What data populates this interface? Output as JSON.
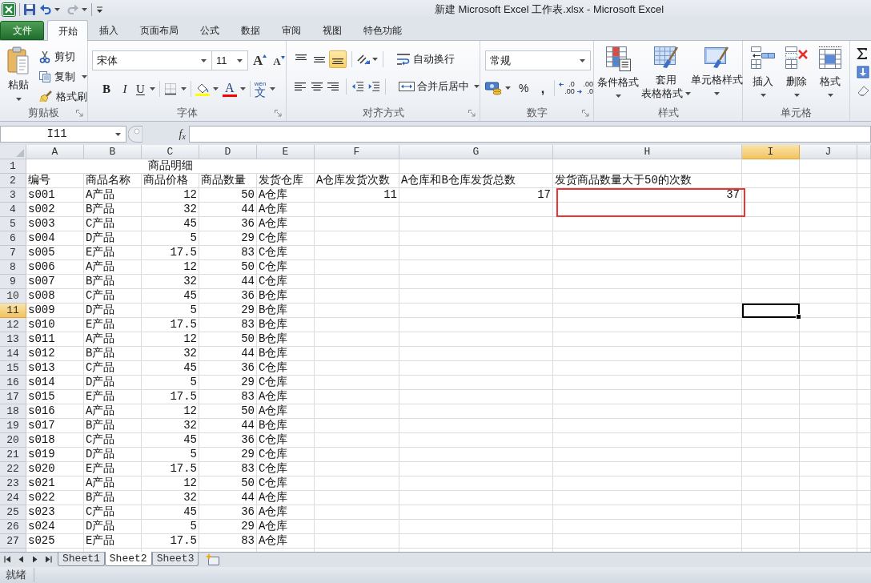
{
  "window": {
    "title": "新建 Microsoft Excel 工作表.xlsx - Microsoft Excel"
  },
  "ribbon_tabs": [
    {
      "label": "文件",
      "kind": "file",
      "selected": false
    },
    {
      "label": "开始",
      "kind": "tab",
      "selected": true
    },
    {
      "label": "插入",
      "kind": "tab",
      "selected": false
    },
    {
      "label": "页面布局",
      "kind": "tab",
      "selected": false
    },
    {
      "label": "公式",
      "kind": "tab",
      "selected": false
    },
    {
      "label": "数据",
      "kind": "tab",
      "selected": false
    },
    {
      "label": "审阅",
      "kind": "tab",
      "selected": false
    },
    {
      "label": "视图",
      "kind": "tab",
      "selected": false
    },
    {
      "label": "特色功能",
      "kind": "tab",
      "selected": false
    }
  ],
  "clipboard": {
    "label": "剪贴板",
    "paste": "粘贴",
    "cut": "剪切",
    "copy": "复制",
    "format_painter": "格式刷"
  },
  "font": {
    "label": "字体",
    "name": "宋体",
    "size": "11",
    "grow": "A",
    "shrink": "A",
    "bold": "B",
    "italic": "I",
    "underline": "U",
    "color_letter": "A",
    "phonetic": "wén",
    "phonetic_char": "文"
  },
  "alignment": {
    "label": "对齐方式",
    "vertical": [
      {
        "kind": "top",
        "selected": false
      },
      {
        "kind": "middle",
        "selected": false
      },
      {
        "kind": "bottom",
        "selected": true
      }
    ],
    "horizontal": [
      {
        "kind": "left",
        "selected": false
      },
      {
        "kind": "center",
        "selected": false
      },
      {
        "kind": "right",
        "selected": false
      }
    ],
    "wrap_text": "自动换行",
    "merge_center": "合并后居中"
  },
  "number": {
    "label": "数字",
    "format": "常规",
    "percent": "%",
    "comma": ",",
    "increase_decimal": [
      ".0",
      ".00"
    ],
    "decrease_decimal": [
      ".00",
      ".0"
    ]
  },
  "styles": {
    "label": "样式",
    "buttons": [
      {
        "kind": "conditional",
        "lines": [
          "条件格式"
        ]
      },
      {
        "kind": "table",
        "lines": [
          "套用",
          "表格格式"
        ]
      },
      {
        "kind": "cell",
        "lines": [
          "单元格样式"
        ]
      }
    ]
  },
  "cells": {
    "label": "单元格",
    "buttons": [
      {
        "kind": "insert",
        "label": "插入"
      },
      {
        "kind": "delete",
        "label": "删除"
      },
      {
        "kind": "format",
        "label": "格式"
      }
    ]
  },
  "formula_bar": {
    "name_box": "I11",
    "fx": "f$_{x}$"
  },
  "sheet": {
    "columns": [
      {
        "label": "A",
        "selected": false
      },
      {
        "label": "B",
        "selected": false
      },
      {
        "label": "C",
        "selected": false
      },
      {
        "label": "D",
        "selected": false
      },
      {
        "label": "E",
        "selected": false
      },
      {
        "label": "F",
        "selected": false
      },
      {
        "label": "G",
        "selected": false
      },
      {
        "label": "H",
        "selected": false
      },
      {
        "label": "I",
        "selected": true
      },
      {
        "label": "J",
        "selected": false
      }
    ],
    "rows": [
      {
        "label": "1",
        "selected": false
      },
      {
        "label": "2",
        "selected": false
      },
      {
        "label": "3",
        "selected": false
      },
      {
        "label": "4",
        "selected": false
      },
      {
        "label": "5",
        "selected": false
      },
      {
        "label": "6",
        "selected": false
      },
      {
        "label": "7",
        "selected": false
      },
      {
        "label": "8",
        "selected": false
      },
      {
        "label": "9",
        "selected": false
      },
      {
        "label": "10",
        "selected": false
      },
      {
        "label": "11",
        "selected": true
      },
      {
        "label": "12",
        "selected": false
      },
      {
        "label": "13",
        "selected": false
      },
      {
        "label": "14",
        "selected": false
      },
      {
        "label": "15",
        "selected": false
      },
      {
        "label": "16",
        "selected": false
      },
      {
        "label": "17",
        "selected": false
      },
      {
        "label": "18",
        "selected": false
      },
      {
        "label": "19",
        "selected": false
      },
      {
        "label": "20",
        "selected": false
      },
      {
        "label": "21",
        "selected": false
      },
      {
        "label": "22",
        "selected": false
      },
      {
        "label": "23",
        "selected": false
      },
      {
        "label": "24",
        "selected": false
      },
      {
        "label": "25",
        "selected": false
      },
      {
        "label": "26",
        "selected": false
      },
      {
        "label": "27",
        "selected": false
      }
    ],
    "title": "商品明细",
    "headers": [
      "编号",
      "商品名称",
      "商品价格",
      "商品数量",
      "发货仓库",
      "A仓库发货次数",
      "A仓库和B仓库发货总数",
      "发货商品数量大于50的次数"
    ],
    "summary": [
      "11",
      "17",
      "37"
    ],
    "records": [
      {
        "id": "s001",
        "name": "A产品",
        "price": "12",
        "quantity": "50",
        "warehouse": "A仓库"
      },
      {
        "id": "s002",
        "name": "B产品",
        "price": "32",
        "quantity": "44",
        "warehouse": "A仓库"
      },
      {
        "id": "s003",
        "name": "C产品",
        "price": "45",
        "quantity": "36",
        "warehouse": "A仓库"
      },
      {
        "id": "s004",
        "name": "D产品",
        "price": "5",
        "quantity": "29",
        "warehouse": "C仓库"
      },
      {
        "id": "s005",
        "name": "E产品",
        "price": "17.5",
        "quantity": "83",
        "warehouse": "C仓库"
      },
      {
        "id": "s006",
        "name": "A产品",
        "price": "12",
        "quantity": "50",
        "warehouse": "C仓库"
      },
      {
        "id": "s007",
        "name": "B产品",
        "price": "32",
        "quantity": "44",
        "warehouse": "C仓库"
      },
      {
        "id": "s008",
        "name": "C产品",
        "price": "45",
        "quantity": "36",
        "warehouse": "B仓库"
      },
      {
        "id": "s009",
        "name": "D产品",
        "price": "5",
        "quantity": "29",
        "warehouse": "B仓库"
      },
      {
        "id": "s010",
        "name": "E产品",
        "price": "17.5",
        "quantity": "83",
        "warehouse": "B仓库"
      },
      {
        "id": "s011",
        "name": "A产品",
        "price": "12",
        "quantity": "50",
        "warehouse": "B仓库"
      },
      {
        "id": "s012",
        "name": "B产品",
        "price": "32",
        "quantity": "44",
        "warehouse": "B仓库"
      },
      {
        "id": "s013",
        "name": "C产品",
        "price": "45",
        "quantity": "36",
        "warehouse": "C仓库"
      },
      {
        "id": "s014",
        "name": "D产品",
        "price": "5",
        "quantity": "29",
        "warehouse": "C仓库"
      },
      {
        "id": "s015",
        "name": "E产品",
        "price": "17.5",
        "quantity": "83",
        "warehouse": "A仓库"
      },
      {
        "id": "s016",
        "name": "A产品",
        "price": "12",
        "quantity": "50",
        "warehouse": "A仓库"
      },
      {
        "id": "s017",
        "name": "B产品",
        "price": "32",
        "quantity": "44",
        "warehouse": "B仓库"
      },
      {
        "id": "s018",
        "name": "C产品",
        "price": "45",
        "quantity": "36",
        "warehouse": "C仓库"
      },
      {
        "id": "s019",
        "name": "D产品",
        "price": "5",
        "quantity": "29",
        "warehouse": "C仓库"
      },
      {
        "id": "s020",
        "name": "E产品",
        "price": "17.5",
        "quantity": "83",
        "warehouse": "C仓库"
      },
      {
        "id": "s021",
        "name": "A产品",
        "price": "12",
        "quantity": "50",
        "warehouse": "C仓库"
      },
      {
        "id": "s022",
        "name": "B产品",
        "price": "32",
        "quantity": "44",
        "warehouse": "A仓库"
      },
      {
        "id": "s023",
        "name": "C产品",
        "price": "45",
        "quantity": "36",
        "warehouse": "A仓库"
      },
      {
        "id": "s024",
        "name": "D产品",
        "price": "5",
        "quantity": "29",
        "warehouse": "A仓库"
      },
      {
        "id": "s025",
        "name": "E产品",
        "price": "17.5",
        "quantity": "83",
        "warehouse": "A仓库"
      }
    ]
  },
  "annotations": [
    {
      "kind": "rectangle"
    }
  ],
  "sheet_tabs": [
    {
      "label": "Sheet1",
      "selected": false
    },
    {
      "label": "Sheet2",
      "selected": true
    },
    {
      "label": "Sheet3",
      "selected": false
    }
  ],
  "status_bar": {
    "text": "就绪"
  }
}
